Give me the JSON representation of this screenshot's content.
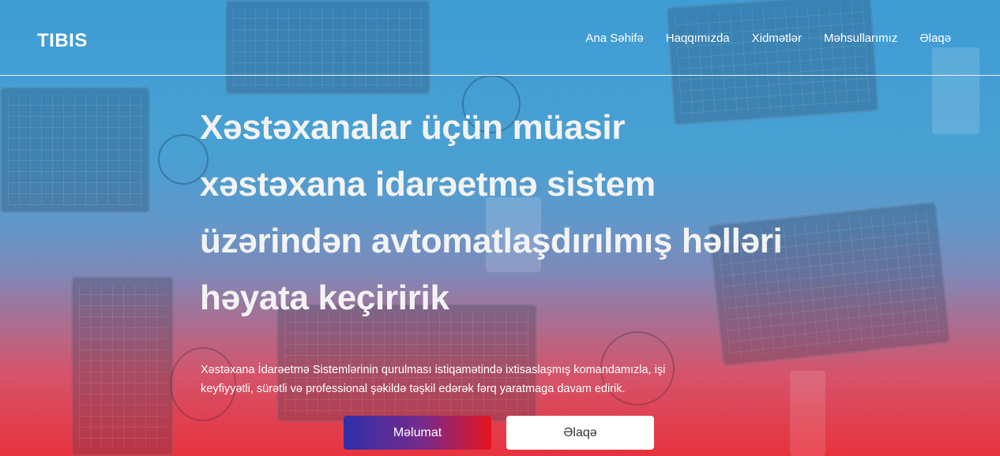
{
  "header": {
    "logo": "TIBIS",
    "nav": [
      "Ana Səhifə",
      "Haqqımızda",
      "Xidmətlər",
      "Məhsullarımız",
      "Əlaqə"
    ]
  },
  "hero": {
    "headline_lines": [
      "Xəstəxanalar üçün müasir",
      "xəstəxana idarəetmə sistem",
      "üzərindən avtomatlaşdırılmış həlləri",
      "həyata keçiririk"
    ],
    "subtitle_lines": [
      "Xəstəxana İdarəetmə Sistemlərinin qurulması istiqamətində ixtisaslaşmış komandamızla, işi",
      "keyfiyyətli, sürətli və professional şəkildə təşkil edərək fərq yaratmaga davam edirik."
    ],
    "buttons": {
      "info": "Məlumat",
      "contact": "Əlaqə"
    }
  },
  "colors": {
    "gradient_top": "#3f9fd6",
    "gradient_bottom": "#e8333e",
    "button_gradient_start": "#2f2fa8",
    "button_gradient_end": "#e6141c",
    "text": "#ffffff"
  }
}
